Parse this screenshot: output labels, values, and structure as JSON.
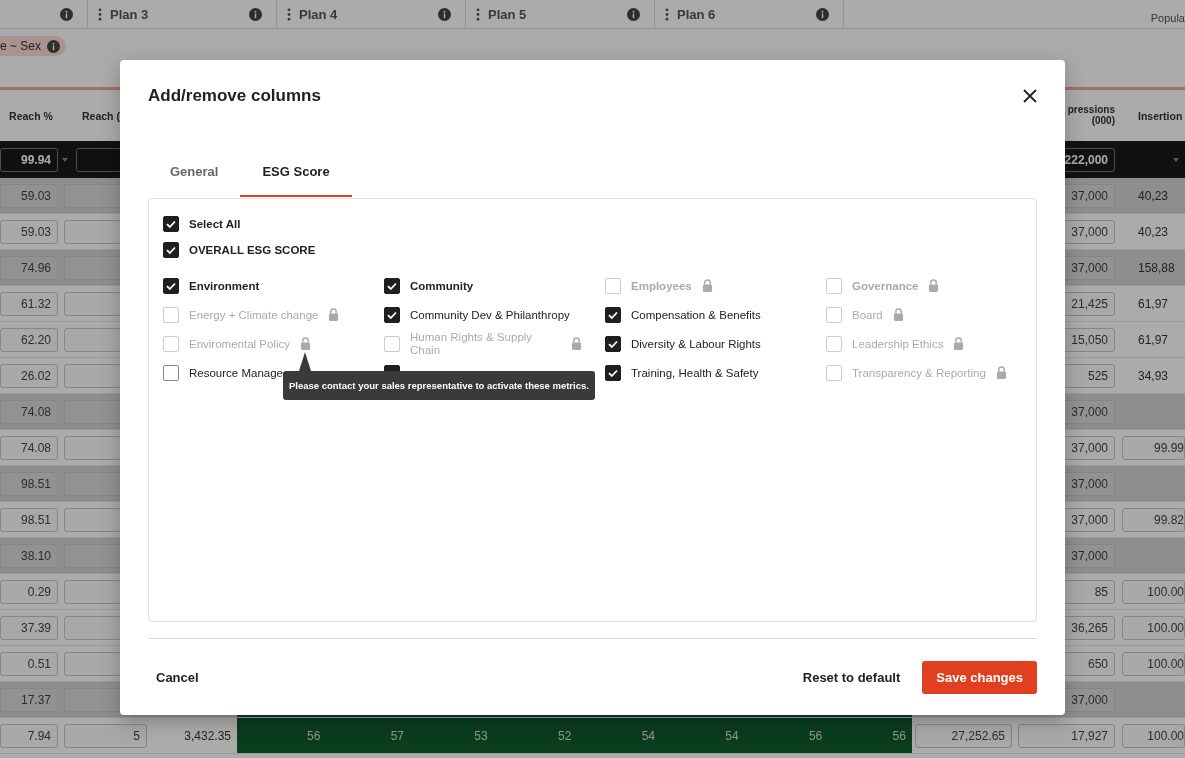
{
  "top_bar": {
    "plans": [
      "Plan 3",
      "Plan 4",
      "Plan 5",
      "Plan 6"
    ],
    "column_note": "Popula"
  },
  "filter_chip": "e ~ Sex",
  "table": {
    "columns": [
      "Reach %",
      "Reach (",
      "pressions (000)",
      "Insertion"
    ]
  },
  "summary": {
    "reach_pct": "99.94",
    "impressions": "222,000"
  },
  "rows": [
    {
      "shaded": true,
      "reach_pct": "59.03",
      "impressions": "37,000",
      "insertions": {
        "kind": "plain",
        "text": "40,23"
      }
    },
    {
      "shaded": false,
      "reach_pct": "59.03",
      "impressions": "37,000",
      "insertions": {
        "kind": "plain",
        "text": "40,23"
      }
    },
    {
      "shaded": true,
      "reach_pct": "74.96",
      "impressions": "37,000",
      "insertions": {
        "kind": "plain",
        "text": "158,88"
      }
    },
    {
      "shaded": false,
      "reach_pct": "61.32",
      "impressions": "21,425",
      "insertions": {
        "kind": "plain",
        "text": "61,97"
      }
    },
    {
      "shaded": false,
      "reach_pct": "62.20",
      "impressions": "15,050",
      "insertions": {
        "kind": "plain",
        "text": "61,97"
      }
    },
    {
      "shaded": false,
      "reach_pct": "26.02",
      "impressions": "525",
      "insertions": {
        "kind": "plain",
        "text": "34,93"
      }
    },
    {
      "shaded": true,
      "reach_pct": "74.08",
      "impressions": "37,000"
    },
    {
      "shaded": false,
      "reach_pct": "74.08",
      "impressions": "37,000",
      "insertions": {
        "kind": "field",
        "text": "99.99"
      }
    },
    {
      "shaded": true,
      "reach_pct": "98.51",
      "impressions": "37,000"
    },
    {
      "shaded": false,
      "reach_pct": "98.51",
      "impressions": "37,000",
      "insertions": {
        "kind": "field",
        "text": "99.82"
      }
    },
    {
      "shaded": true,
      "reach_pct": "38.10",
      "impressions": "37,000"
    },
    {
      "shaded": false,
      "reach_pct": "0.29",
      "impressions": "85",
      "insertions": {
        "kind": "field",
        "text": "100.00"
      }
    },
    {
      "shaded": false,
      "reach_pct": "37.39",
      "impressions": "36,265",
      "insertions": {
        "kind": "field",
        "text": "100.00"
      }
    },
    {
      "shaded": false,
      "reach_pct": "0.51",
      "impressions": "650",
      "insertions": {
        "kind": "field",
        "text": "100.00"
      }
    },
    {
      "shaded": true,
      "reach_pct": "17.37",
      "impressions": "37,000"
    },
    {
      "shaded": false,
      "reach_pct": "7.94",
      "reach": "5",
      "column_3": "3,432.35",
      "plan_values": [
        "56",
        "57",
        "53",
        "52",
        "54",
        "54",
        "56",
        "56"
      ],
      "column_8": "27,252.65",
      "impressions": "17,927",
      "insertions": {
        "kind": "field",
        "text": "100.00"
      }
    }
  ],
  "modal": {
    "title": "Add/remove columns",
    "tabs": [
      {
        "label": "General",
        "selected": false
      },
      {
        "label": "ESG Score",
        "selected": true
      }
    ],
    "select_all": {
      "label": "Select All",
      "checked": true
    },
    "overall": {
      "label": "OVERALL ESG SCORE",
      "checked": true
    },
    "groups": [
      {
        "label": "Environment",
        "checked": true,
        "locked": false,
        "items": [
          {
            "label": "Energy + Climate change",
            "checked": false,
            "locked": true
          },
          {
            "label": "Enviromental Policy",
            "checked": false,
            "locked": true,
            "tooltip": "Please contact your sales representative to activate these metrics."
          },
          {
            "label": "Resource Manage",
            "checked": false,
            "locked": false
          }
        ]
      },
      {
        "label": "Community",
        "checked": true,
        "locked": false,
        "items": [
          {
            "label": "Community Dev & Philanthropy",
            "checked": true,
            "locked": false
          },
          {
            "label": "Human Rights & Supply Chain",
            "checked": false,
            "locked": true
          },
          {
            "checked": true
          }
        ]
      },
      {
        "label": "Employees",
        "checked": false,
        "locked": true,
        "items": [
          {
            "label": "Compensation & Benefits",
            "checked": true,
            "locked": false
          },
          {
            "label": "Diversity & Labour Rights",
            "checked": true,
            "locked": false
          },
          {
            "label": "Training, Health & Safety",
            "checked": true,
            "locked": false
          }
        ]
      },
      {
        "label": "Governance",
        "checked": false,
        "locked": true,
        "items": [
          {
            "label": "Board",
            "checked": false,
            "locked": true
          },
          {
            "label": "Leadership Ethics",
            "checked": false,
            "locked": true
          },
          {
            "label": "Transparency & Reporting",
            "checked": false,
            "locked": true
          }
        ]
      }
    ],
    "buttons": {
      "cancel": "Cancel",
      "reset": "Reset to default",
      "save": "Save changes"
    }
  }
}
